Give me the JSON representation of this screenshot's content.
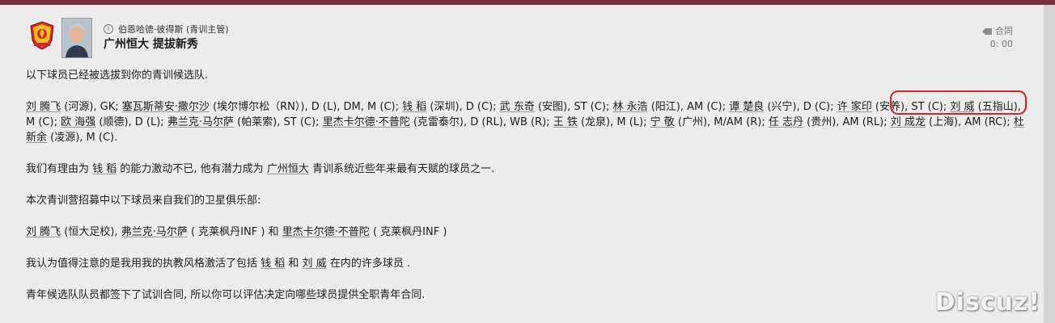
{
  "header": {
    "sender_name": "伯恩哈德·彼得斯 (青训主管)",
    "subject": "广州恒大 提拔新秀",
    "tag_label": "合同",
    "time": "0: 00"
  },
  "body": {
    "intro": "以下球员已经被选拔到你的青训候选队.",
    "players": [
      {
        "name": "刘 腾飞",
        "info": " (河源), GK; "
      },
      {
        "name": "塞瓦斯蒂安·撒尔沙",
        "info": " (埃尔博尔松（RN）), D (L), DM, M (C); "
      },
      {
        "name": "钱 稻",
        "info": " (深圳), D (C); "
      },
      {
        "name": "武 东奇",
        "info": " (安图), ST (C); "
      },
      {
        "name": "林 永浩",
        "info": " (阳江), AM (C); "
      },
      {
        "name": "谭 楚良",
        "info": " (兴宁), D (C); "
      },
      {
        "name": "许 家印",
        "info": " (安养), ST (C); "
      },
      {
        "name": "刘 威",
        "info": " (五指山), M (C); "
      },
      {
        "name": "欧 海强",
        "info": " (顺德), D (L); "
      },
      {
        "name": "弗兰克·马尔萨",
        "info": " (帕莱索), ST (C); "
      },
      {
        "name": "里杰卡尔德·不普陀",
        "info": " (克雷泰尔), D (RL), WB (R); "
      },
      {
        "name": "王 铁",
        "info": " (龙泉), M (L); "
      },
      {
        "name": "宁 敬",
        "info": " (广州), M/AM (R); "
      },
      {
        "name": "任 志丹",
        "info": " (贵州), AM (RL); "
      },
      {
        "name": "刘 成龙",
        "info": " (上海), AM (RC); "
      },
      {
        "name": "杜 新余",
        "info": " (凌源), M (C)."
      }
    ],
    "potential_prefix": "我们有理由为 ",
    "potential_player": "钱 稻",
    "potential_middle": " 的能力激动不已, 他有潜力成为 ",
    "potential_club": "广州恒大",
    "potential_suffix": " 青训系统近些年来最有天赋的球员之一.",
    "affiliate_intro": "本次青训营招募中以下球员来自我们的卫星俱乐部:",
    "affiliate_p1": "刘 腾飞",
    "affiliate_p1_club": " (恒大足校), ",
    "affiliate_p2": "弗兰克·马尔萨",
    "affiliate_p2_club": " ( 克莱枫丹INF ) 和 ",
    "affiliate_p3": "里杰卡尔德·不普陀",
    "affiliate_p3_club": " ( 克莱枫丹INF )",
    "style_prefix": "我认为值得注意的是我用我的执教风格激活了包括 ",
    "style_p1": "钱 稻",
    "style_and": " 和 ",
    "style_p2": "刘 威",
    "style_suffix": " 在内的许多球员 .",
    "closing": "青年候选队队员都签下了试训合同, 所以你可以评估决定向哪些球员提供全职青年合同."
  },
  "watermark": "Discuz!",
  "colors": {
    "top_bar": "#7a3038",
    "annotation": "#e02020",
    "background": "#ececec"
  }
}
